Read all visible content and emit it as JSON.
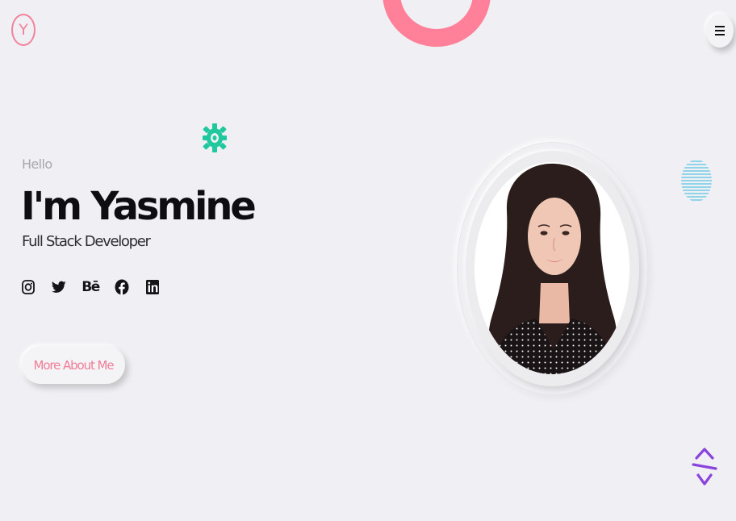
{
  "header": {
    "logo_letter": "Y",
    "menu_icon": "hamburger-menu-icon"
  },
  "hero": {
    "greeting": "Hello",
    "headline": "I'm Yasmine",
    "role": "Full Stack Developer",
    "cta_label": "More About Me"
  },
  "socials": [
    {
      "name": "Instagram",
      "icon": "instagram-icon"
    },
    {
      "name": "Twitter",
      "icon": "twitter-icon"
    },
    {
      "name": "Behance",
      "icon": "behance-icon",
      "glyph": "Bē"
    },
    {
      "name": "Facebook",
      "icon": "facebook-icon"
    },
    {
      "name": "LinkedIn",
      "icon": "linkedin-icon"
    }
  ],
  "decorations": {
    "top_ring": "pink-half-ring",
    "gear": "green-gear-icon",
    "stripe_ball": "striped-circle",
    "scroll_arrows": "up-down-arrows-icon"
  },
  "colors": {
    "background": "#f0f0f4",
    "accent_pink": "#f2829b",
    "ring_pink": "#ff8098",
    "gear_green": "#1fc89d",
    "stripe_blue": "#56c4e2",
    "arrow_purple": "#8a44dc",
    "headline": "#0e0e12"
  }
}
